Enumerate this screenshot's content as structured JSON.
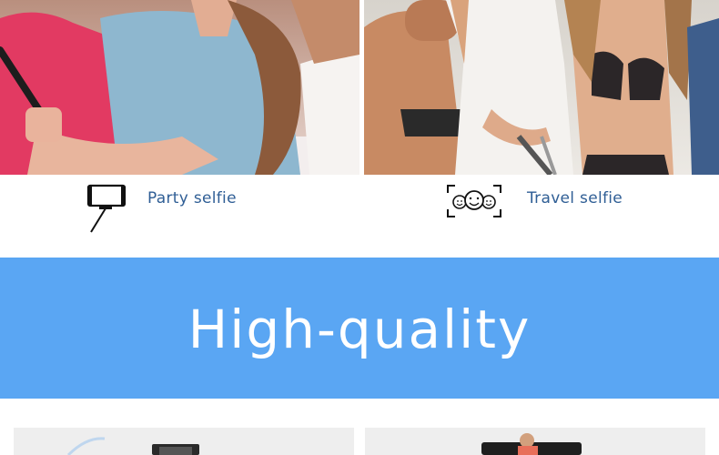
{
  "features": [
    {
      "label": "Party selfie",
      "icon": "selfie-stick-phone-icon"
    },
    {
      "label": "Travel selfie",
      "icon": "group-faces-frame-icon"
    }
  ],
  "banner": {
    "title": "High-quality"
  },
  "colors": {
    "banner": "#5aa6f3",
    "caption_text": "#2f5e95",
    "card_bg": "#eeeeee"
  }
}
